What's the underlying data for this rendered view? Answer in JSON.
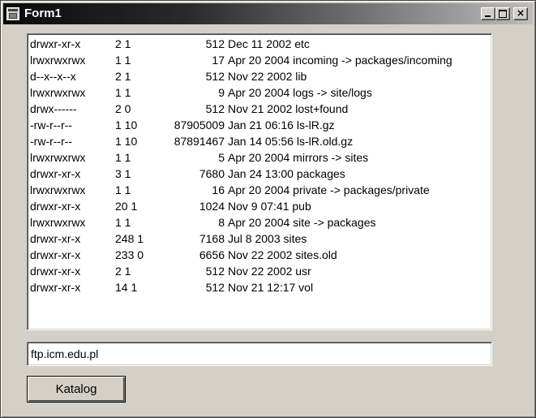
{
  "window": {
    "title": "Form1"
  },
  "title_buttons": {
    "minimize_icon": "minimize-icon",
    "maximize_icon": "maximize-icon",
    "close_label": "×"
  },
  "listing": {
    "rows": [
      {
        "perm": "drwxr-xr-x",
        "links": "2 1",
        "size": "512",
        "rest": "Dec 11  2002 etc"
      },
      {
        "perm": "lrwxrwxrwx",
        "links": "1 1",
        "size": "17",
        "rest": "Apr 20  2004 incoming -> packages/incoming"
      },
      {
        "perm": "d--x--x--x",
        "links": "2 1",
        "size": "512",
        "rest": "Nov 22  2002 lib"
      },
      {
        "perm": "lrwxrwxrwx",
        "links": "1 1",
        "size": "9",
        "rest": "Apr 20  2004 logs -> site/logs"
      },
      {
        "perm": "drwx------",
        "links": "2 0",
        "size": "512",
        "rest": "Nov 21  2002 lost+found"
      },
      {
        "perm": "-rw-r--r--",
        "links": "1 10",
        "size": "87905009",
        "rest": "Jan 21 06:16 ls-lR.gz"
      },
      {
        "perm": "-rw-r--r--",
        "links": "1 10",
        "size": "87891467",
        "rest": "Jan 14 05:56 ls-lR.old.gz"
      },
      {
        "perm": "lrwxrwxrwx",
        "links": "1 1",
        "size": "5",
        "rest": "Apr 20  2004 mirrors -> sites"
      },
      {
        "perm": "drwxr-xr-x",
        "links": "3 1",
        "size": "7680",
        "rest": "Jan 24 13:00 packages"
      },
      {
        "perm": "lrwxrwxrwx",
        "links": "1 1",
        "size": "16",
        "rest": "Apr 20  2004 private -> packages/private"
      },
      {
        "perm": "drwxr-xr-x",
        "links": "20 1",
        "size": "1024",
        "rest": "Nov  9 07:41 pub"
      },
      {
        "perm": "lrwxrwxrwx",
        "links": "1 1",
        "size": "8",
        "rest": "Apr 20  2004 site -> packages"
      },
      {
        "perm": "drwxr-xr-x",
        "links": "248 1",
        "size": "7168",
        "rest": "Jul  8  2003 sites"
      },
      {
        "perm": "drwxr-xr-x",
        "links": "233 0",
        "size": "6656",
        "rest": "Nov 22  2002 sites.old"
      },
      {
        "perm": "drwxr-xr-x",
        "links": "2 1",
        "size": "512",
        "rest": "Nov 22  2002 usr"
      },
      {
        "perm": "drwxr-xr-x",
        "links": "14 1",
        "size": "512",
        "rest": "Nov 21 12:17 vol"
      }
    ]
  },
  "host_input": {
    "value": "ftp.icm.edu.pl"
  },
  "katalog_button": {
    "label": "Katalog"
  }
}
